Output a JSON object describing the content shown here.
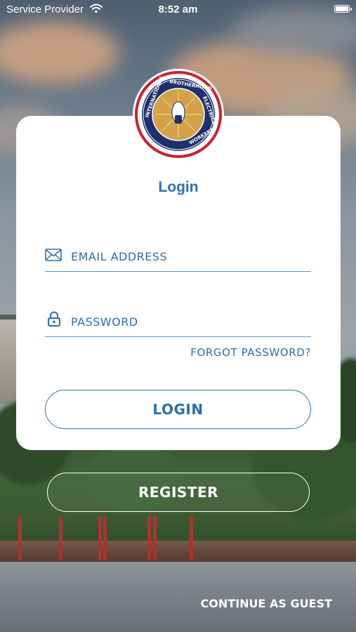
{
  "status_bar": {
    "carrier": "Service Provider",
    "time": "8:52 am",
    "icons": [
      "wifi-icon",
      "battery-icon"
    ]
  },
  "logo": {
    "name": "ibew-seal",
    "ring_text": "INTERNATIONAL BROTHERHOOD OF ELECTRICAL WORKERS"
  },
  "login_card": {
    "title": "Login",
    "email": {
      "placeholder": "EMAIL ADDRESS",
      "value": "",
      "icon": "envelope-icon"
    },
    "password": {
      "placeholder": "PASSWORD",
      "value": "",
      "icon": "lock-icon"
    },
    "forgot_password": "FORGOT PASSWORD?",
    "login_button": "LOGIN"
  },
  "register_button": "REGISTER",
  "continue_as_guest": "CONTINUE AS GUEST",
  "colors": {
    "accent": "#2e6fa8",
    "title": "#2a72b3",
    "logo_ring": "#c8232c",
    "logo_navy": "#1e2f6b",
    "logo_gold": "#d4a24a"
  }
}
